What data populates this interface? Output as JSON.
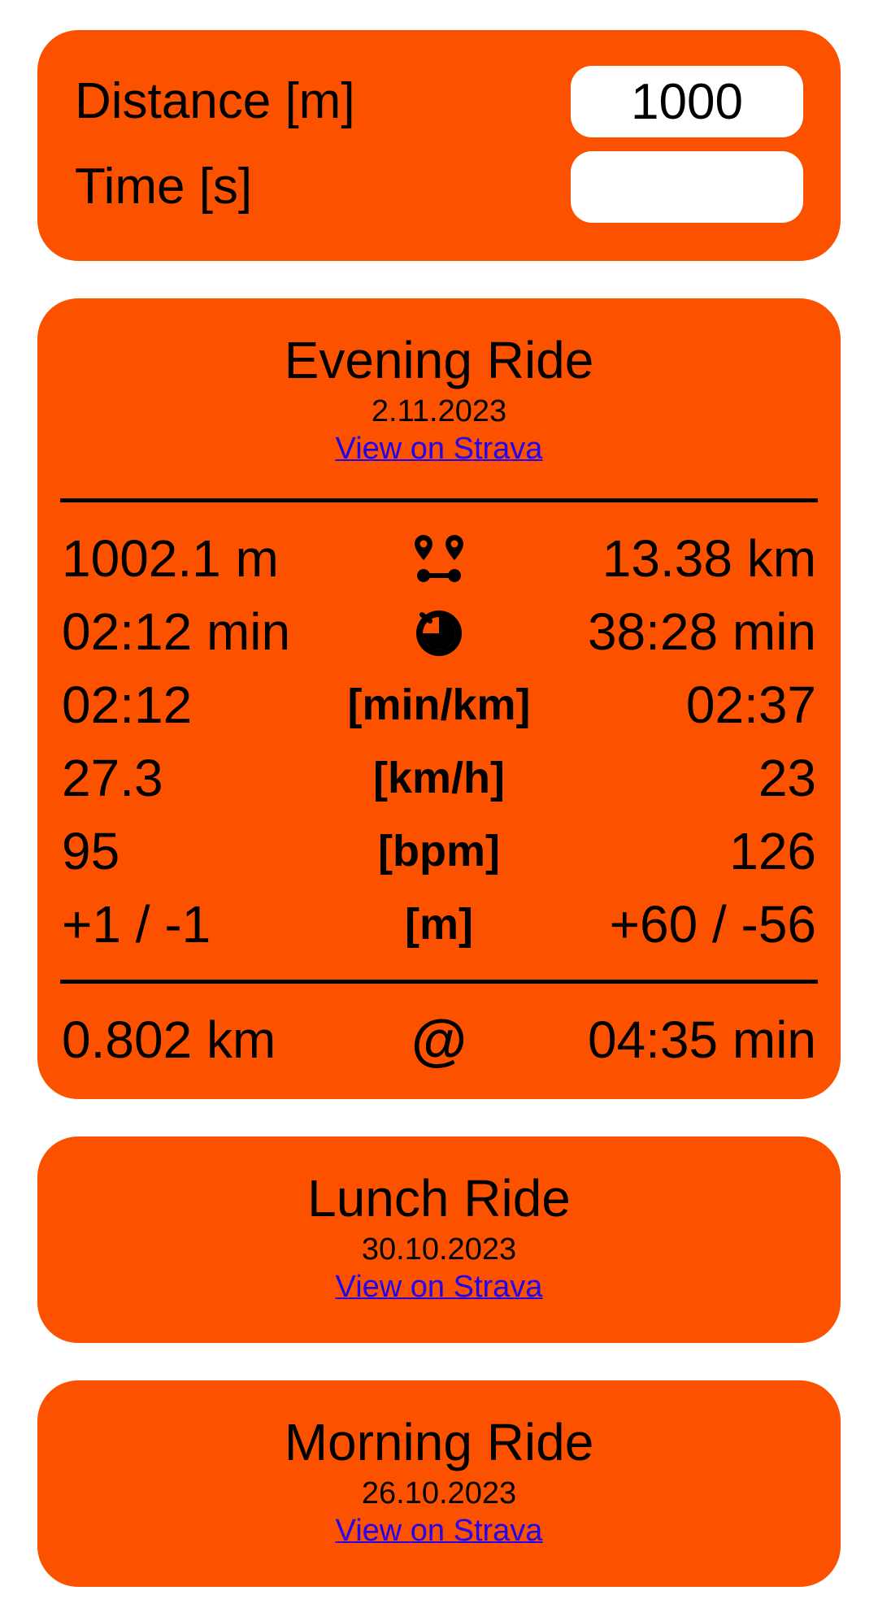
{
  "input_form": {
    "distance_label": "Distance [m]",
    "distance_value": "1000",
    "time_label": "Time [s]",
    "time_value": ""
  },
  "activities": [
    {
      "title": "Evening Ride",
      "date": "2.11.2023",
      "link_text": "View on Strava",
      "stats": [
        {
          "left": "1002.1 m",
          "middle": "",
          "icon": "route-pins-icon",
          "right": "13.38 km"
        },
        {
          "left": "02:12 min",
          "middle": "",
          "icon": "stopwatch-icon",
          "right": "38:28 min"
        },
        {
          "left": "02:12",
          "middle": "[min/km]",
          "right": "02:37"
        },
        {
          "left": "27.3",
          "middle": "[km/h]",
          "right": "23"
        },
        {
          "left": "95",
          "middle": "[bpm]",
          "right": "126"
        },
        {
          "left": "+1 / -1",
          "middle": "[m]",
          "right": "+60 / -56"
        }
      ],
      "segment": {
        "left": "0.802 km",
        "middle": "@",
        "right": "04:35 min"
      }
    },
    {
      "title": "Lunch Ride",
      "date": "30.10.2023",
      "link_text": "View on Strava"
    },
    {
      "title": "Morning Ride",
      "date": "26.10.2023",
      "link_text": "View on Strava"
    }
  ],
  "colors": {
    "card_background": "#fc5200",
    "link": "#2200ee",
    "input_background": "#ffffff"
  }
}
